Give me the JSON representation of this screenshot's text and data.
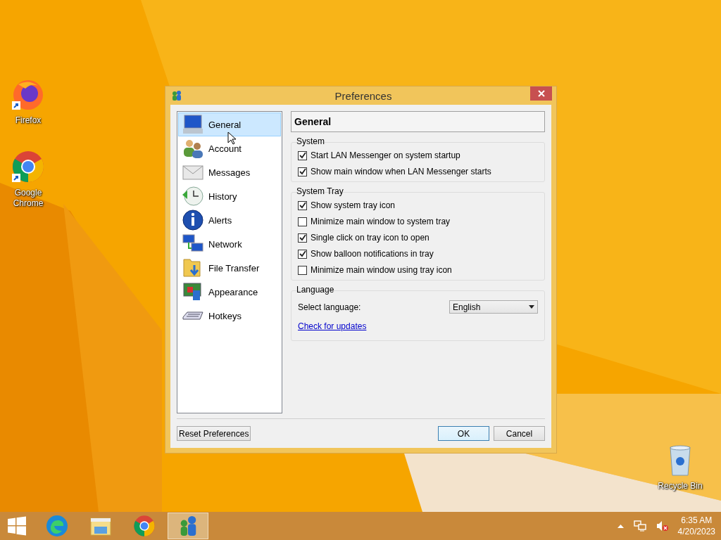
{
  "desktop_icons": [
    {
      "label": "Firefox"
    },
    {
      "label": "Google Chrome"
    },
    {
      "label": "Recycle Bin"
    }
  ],
  "dialog": {
    "title": "Preferences",
    "sidebar": {
      "items": [
        {
          "label": "General",
          "selected": true
        },
        {
          "label": "Account",
          "selected": false
        },
        {
          "label": "Messages",
          "selected": false
        },
        {
          "label": "History",
          "selected": false
        },
        {
          "label": "Alerts",
          "selected": false
        },
        {
          "label": "Network",
          "selected": false
        },
        {
          "label": "File Transfer",
          "selected": false
        },
        {
          "label": "Appearance",
          "selected": false
        },
        {
          "label": "Hotkeys",
          "selected": false
        }
      ]
    },
    "header": "General",
    "groups": [
      {
        "title": "System",
        "items": [
          {
            "kind": "checkbox",
            "label": "Start LAN Messenger on system startup",
            "checked": true
          },
          {
            "kind": "checkbox",
            "label": "Show main window when LAN Messenger starts",
            "checked": true
          }
        ]
      },
      {
        "title": "System Tray",
        "items": [
          {
            "kind": "checkbox",
            "label": "Show system tray icon",
            "checked": true
          },
          {
            "kind": "checkbox",
            "label": "Minimize main window to system tray",
            "checked": false
          },
          {
            "kind": "checkbox",
            "label": "Single click on tray icon to open",
            "checked": true
          },
          {
            "kind": "checkbox",
            "label": "Show balloon notifications in tray",
            "checked": true
          },
          {
            "kind": "checkbox",
            "label": "Minimize main window using tray icon",
            "checked": false
          }
        ]
      },
      {
        "title": "Language",
        "items": [
          {
            "kind": "select",
            "label": "Select language:",
            "value": "English"
          },
          {
            "kind": "link",
            "label": "Check for updates"
          }
        ]
      }
    ],
    "buttons": [
      {
        "label": "Reset Preferences",
        "kind": "left",
        "focused": false
      },
      {
        "label": "OK",
        "kind": "right",
        "focused": true
      },
      {
        "label": "Cancel",
        "kind": "right",
        "focused": false
      }
    ]
  },
  "taskbar": {
    "apps": [
      {
        "selected": false
      },
      {
        "selected": false
      },
      {
        "selected": false
      },
      {
        "selected": true
      }
    ],
    "time": "6:35 AM",
    "date": "4/20/2023"
  }
}
